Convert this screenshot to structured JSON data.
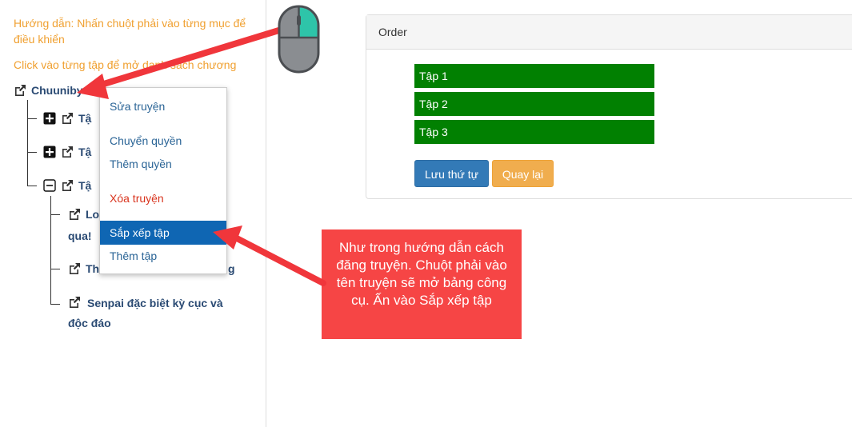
{
  "hints": {
    "instruction": "Hướng dẫn: Nhấn chuột phải vào từng mục để điều khiển",
    "click_volume": "Click vào từng tập để mở danh sách chương"
  },
  "tree": {
    "root_label": "Chuuniby",
    "volume_1_label": "Tậ",
    "volume_2_label": "Tậ",
    "volume_3_label": "Tậ",
    "chapter_1_label": "Lo",
    "chapter_1_cont": "qua!",
    "chapter_2_label": "Th",
    "chapter_2_tail": "g",
    "chapter_3_label": "Senpai đặc biệt kỳ cục và độc đáo"
  },
  "context_menu": {
    "items": [
      {
        "label": "Sửa truyện"
      },
      {
        "label": "Chuyển quyền"
      },
      {
        "label": "Thêm quyền"
      },
      {
        "label": "Xóa truyện"
      },
      {
        "label": "Sắp xếp tập"
      },
      {
        "label": "Thêm tập"
      }
    ],
    "active_index": 4
  },
  "order_panel": {
    "title": "Order",
    "episodes": [
      "Tập 1",
      "Tập 2",
      "Tập 3"
    ],
    "save_label": "Lưu thứ tự",
    "back_label": "Quay lại"
  },
  "callout": {
    "text": "Như trong hướng dẫn cách đăng truyện. Chuột phải vào tên truyện sẽ mở bảng công cụ. Ấn vào Sắp xếp tập"
  },
  "colors": {
    "hint": "#f0a030",
    "episode_bg": "#018001",
    "menu_active": "#0f66b3",
    "save_button": "#337ab7",
    "back_button": "#f0ad4e",
    "callout_bg": "#f64545",
    "mouse_button": "#2ec4a9"
  }
}
